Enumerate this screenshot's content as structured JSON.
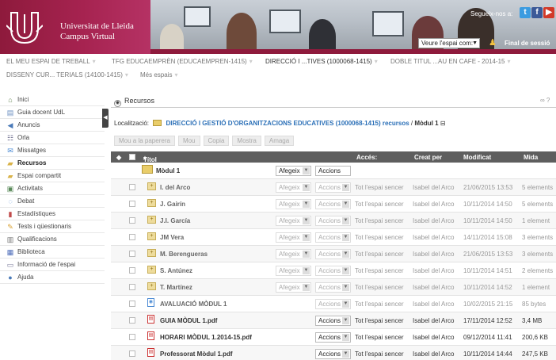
{
  "header": {
    "brand_line1": "Universitat de Lleida",
    "brand_line2": "Campus Virtual",
    "follow_label": "Segueix-nos a:",
    "space_select": "Veure l'espai com:",
    "logout": "Final de sessió",
    "brand_color": "#a62350"
  },
  "topnav": {
    "items": [
      "EL MEU ESPAI DE TREBALL",
      "TFG EDUCAEMPRÈN (EDUCAEMPREN-1415)",
      "DIRECCIÓ I ...TIVES (1000068-1415)",
      "DOBLE TITUL ...AU EN CAFE - 2014-15",
      "DISSENY CUR... TERIALS (14100-1415)",
      "Més espais"
    ]
  },
  "sidebar": {
    "items": [
      {
        "label": "Inici",
        "icon": "home-icon"
      },
      {
        "label": "Guia docent UdL",
        "icon": "document-icon"
      },
      {
        "label": "Anuncis",
        "icon": "megaphone-icon"
      },
      {
        "label": "Orla",
        "icon": "people-icon"
      },
      {
        "label": "Missatges",
        "icon": "message-icon"
      },
      {
        "label": "Recursos",
        "icon": "folder-icon"
      },
      {
        "label": "Espai compartit",
        "icon": "shared-folder-icon"
      },
      {
        "label": "Activitats",
        "icon": "activity-icon"
      },
      {
        "label": "Debat",
        "icon": "chat-bubble-icon"
      },
      {
        "label": "Estadístiques",
        "icon": "bar-chart-icon"
      },
      {
        "label": "Tests i qüestionaris",
        "icon": "pencil-icon"
      },
      {
        "label": "Qualificacions",
        "icon": "grades-icon"
      },
      {
        "label": "Biblioteca",
        "icon": "book-icon"
      },
      {
        "label": "Informació de l'espai",
        "icon": "info-card-icon"
      },
      {
        "label": "Ajuda",
        "icon": "help-icon"
      }
    ],
    "active": "Recursos"
  },
  "main": {
    "title": "Recursos",
    "location_label": "Localització:",
    "location_path": "DIRECCIÓ I GESTIÓ D'ORGANITZACIONS EDUCATIVES (1000068-1415) recursos",
    "location_sep": "/",
    "location_current": "Mòdul 1",
    "toolbar": [
      "Mou a la paperera",
      "Mou",
      "Copia",
      "Mostra",
      "Amaga"
    ]
  },
  "table": {
    "headers": {
      "title": "Títol",
      "access": "Accés:",
      "created_by": "Creat per",
      "modified": "Modificat",
      "size": "Mida"
    },
    "parent": {
      "name": "Mòdul 1",
      "add": "Afegeix",
      "actions": "Accions"
    },
    "rows": [
      {
        "name": "I. del Arco",
        "type": "folder",
        "add": "Afegeix",
        "actions": "Accions",
        "access": "Tot l'espai sencer",
        "creator": "Isabel del Arco",
        "modified": "21/06/2015 13:53",
        "size": "5 elements",
        "style": "muted"
      },
      {
        "name": "J. Gairín",
        "type": "folder",
        "add": "Afegeix",
        "actions": "Accions",
        "access": "Tot l'espai sencer",
        "creator": "Isabel del Arco",
        "modified": "10/11/2014 14:50",
        "size": "5 elements",
        "style": "muted"
      },
      {
        "name": "J.I. García",
        "type": "folder",
        "add": "Afegeix",
        "actions": "Accions",
        "access": "Tot l'espai sencer",
        "creator": "Isabel del Arco",
        "modified": "10/11/2014 14:50",
        "size": "1 element",
        "style": "muted"
      },
      {
        "name": "JM Vera",
        "type": "folder",
        "add": "Afegeix",
        "actions": "Accions",
        "access": "Tot l'espai sencer",
        "creator": "Isabel del Arco",
        "modified": "14/11/2014 15:08",
        "size": "3 elements",
        "style": "muted"
      },
      {
        "name": "M. Berengueras",
        "type": "folder",
        "add": "Afegeix",
        "actions": "Accions",
        "access": "Tot l'espai sencer",
        "creator": "Isabel del Arco",
        "modified": "21/06/2015 13:53",
        "size": "3 elements",
        "style": "muted"
      },
      {
        "name": "S. Antúnez",
        "type": "folder",
        "add": "Afegeix",
        "actions": "Accions",
        "access": "Tot l'espai sencer",
        "creator": "Isabel del Arco",
        "modified": "10/11/2014 14:51",
        "size": "2 elements",
        "style": "muted"
      },
      {
        "name": "T. Martínez",
        "type": "folder",
        "add": "Afegeix",
        "actions": "Accions",
        "access": "Tot l'espai sencer",
        "creator": "Isabel del Arco",
        "modified": "10/11/2014 14:52",
        "size": "1 element",
        "style": "muted"
      },
      {
        "name": "AVALUACIÓ MÒDUL 1",
        "type": "doc",
        "add": "",
        "actions": "Accions",
        "access": "Tot l'espai sencer",
        "creator": "Isabel del Arco",
        "modified": "10/02/2015 21:15",
        "size": "85 bytes",
        "style": "muted"
      },
      {
        "name": "GUIA MÒDUL 1.pdf",
        "type": "pdf",
        "add": "",
        "actions": "Accions",
        "access": "Tot l'espai sencer",
        "creator": "Isabel del Arco",
        "modified": "17/11/2014 12:52",
        "size": "3,4 MB",
        "style": "dark"
      },
      {
        "name": "HORARI MÒDUL 1.2014-15.pdf",
        "type": "pdf",
        "add": "",
        "actions": "Accions",
        "access": "Tot l'espai sencer",
        "creator": "Isabel del Arco",
        "modified": "09/12/2014 11:41",
        "size": "200,6 KB",
        "style": "dark"
      },
      {
        "name": "Professorat Mòdul 1.pdf",
        "type": "pdf",
        "add": "",
        "actions": "Accions",
        "access": "Tot l'espai sencer",
        "creator": "Isabel del Arco",
        "modified": "10/11/2014 14:44",
        "size": "247,5 KB",
        "style": "dark"
      }
    ]
  }
}
